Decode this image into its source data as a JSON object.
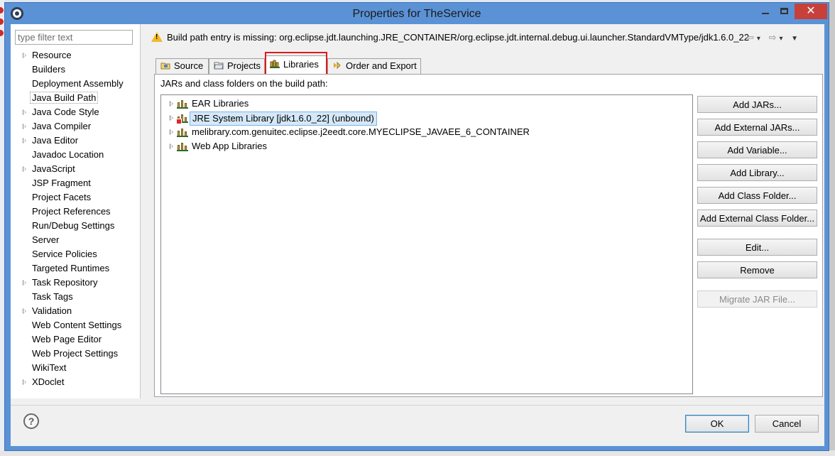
{
  "window": {
    "title": "Properties for TheService"
  },
  "filter": {
    "placeholder": "type filter text"
  },
  "nav": {
    "items": [
      {
        "label": "Resource",
        "expandable": true
      },
      {
        "label": "Builders",
        "expandable": false
      },
      {
        "label": "Deployment Assembly",
        "expandable": false
      },
      {
        "label": "Java Build Path",
        "expandable": false,
        "selected": true
      },
      {
        "label": "Java Code Style",
        "expandable": true
      },
      {
        "label": "Java Compiler",
        "expandable": true
      },
      {
        "label": "Java Editor",
        "expandable": true
      },
      {
        "label": "Javadoc Location",
        "expandable": false
      },
      {
        "label": "JavaScript",
        "expandable": true
      },
      {
        "label": "JSP Fragment",
        "expandable": false
      },
      {
        "label": "Project Facets",
        "expandable": false
      },
      {
        "label": "Project References",
        "expandable": false
      },
      {
        "label": "Run/Debug Settings",
        "expandable": false
      },
      {
        "label": "Server",
        "expandable": false
      },
      {
        "label": "Service Policies",
        "expandable": false
      },
      {
        "label": "Targeted Runtimes",
        "expandable": false
      },
      {
        "label": "Task Repository",
        "expandable": true
      },
      {
        "label": "Task Tags",
        "expandable": false
      },
      {
        "label": "Validation",
        "expandable": true
      },
      {
        "label": "Web Content Settings",
        "expandable": false
      },
      {
        "label": "Web Page Editor",
        "expandable": false
      },
      {
        "label": "Web Project Settings",
        "expandable": false
      },
      {
        "label": "WikiText",
        "expandable": false
      },
      {
        "label": "XDoclet",
        "expandable": true
      }
    ]
  },
  "message": {
    "text": "Build path entry is missing: org.eclipse.jdt.launching.JRE_CONTAINER/org.eclipse.jdt.internal.debug.ui.launcher.StandardVMType/jdk1.6.0_22"
  },
  "tabs": {
    "source": "Source",
    "projects": "Projects",
    "libraries": "Libraries",
    "order": "Order and Export"
  },
  "libraries": {
    "caption": "JARs and class folders on the build path:",
    "entries": [
      {
        "label": "EAR Libraries"
      },
      {
        "label": "JRE System Library [jdk1.6.0_22] (unbound)",
        "selected": true,
        "error": true
      },
      {
        "label": "melibrary.com.genuitec.eclipse.j2eedt.core.MYECLIPSE_JAVAEE_6_CONTAINER"
      },
      {
        "label": "Web App Libraries"
      }
    ]
  },
  "buttons": {
    "add_jars": "Add JARs...",
    "add_external_jars": "Add External JARs...",
    "add_variable": "Add Variable...",
    "add_library": "Add Library...",
    "add_class_folder": "Add Class Folder...",
    "add_external_class_folder": "Add External Class Folder...",
    "edit": "Edit...",
    "remove": "Remove",
    "migrate_jar": "Migrate JAR File..."
  },
  "footer": {
    "help": "?",
    "ok": "OK",
    "cancel": "Cancel"
  }
}
